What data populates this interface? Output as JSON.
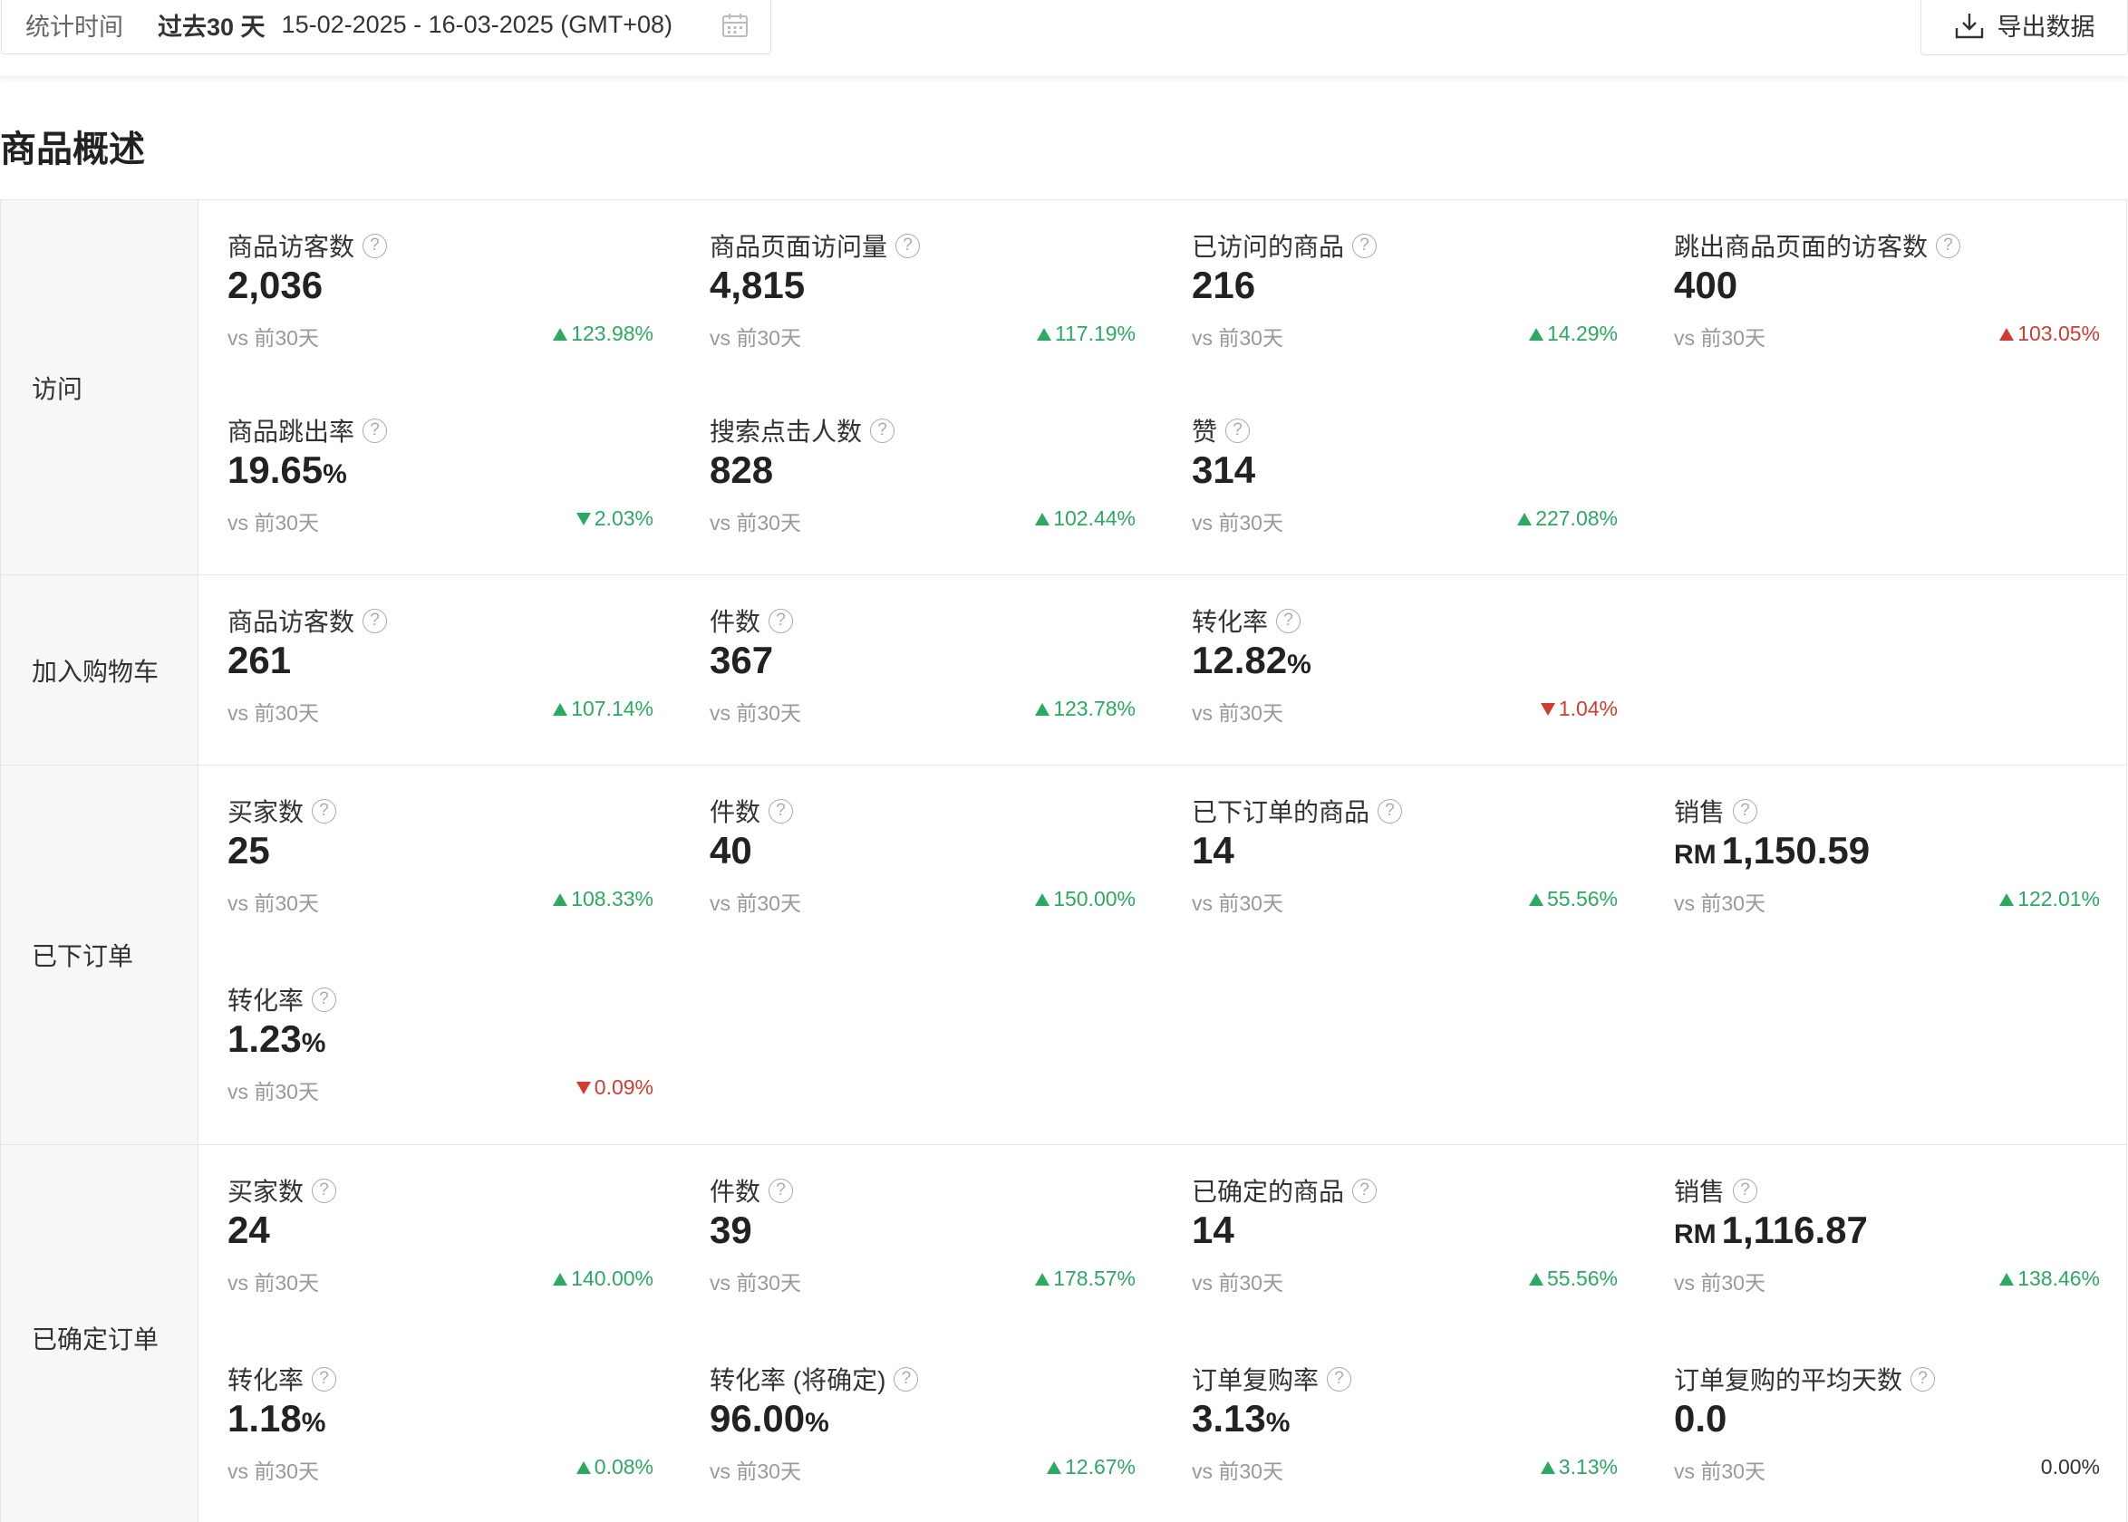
{
  "toolbar": {
    "stat_label": "统计时间",
    "range_label": "过去30 天",
    "date_range": "15-02-2025 - 16-03-2025 (GMT+08)",
    "calendar_icon": "calendar-icon",
    "export_label": "导出数据",
    "export_icon": "download-icon"
  },
  "section_title": "商品概述",
  "colors": {
    "up": "#2bab62",
    "down_red": "#d43b2f",
    "label_bg": "#f7f7f7"
  },
  "groups": [
    {
      "label": "访问",
      "metrics": [
        {
          "title": "商品访客数",
          "value": "2,036",
          "cmp": "vs 前30天",
          "change": "123.98%",
          "dir": "up",
          "color": "green"
        },
        {
          "title": "商品页面访问量",
          "value": "4,815",
          "cmp": "vs 前30天",
          "change": "117.19%",
          "dir": "up",
          "color": "green"
        },
        {
          "title": "已访问的商品",
          "value": "216",
          "cmp": "vs 前30天",
          "change": "14.29%",
          "dir": "up",
          "color": "green"
        },
        {
          "title": "跳出商品页面的访客数",
          "value": "400",
          "cmp": "vs 前30天",
          "change": "103.05%",
          "dir": "up",
          "color": "red"
        },
        {
          "title": "商品跳出率",
          "value": "19.65",
          "unit": "%",
          "cmp": "vs 前30天",
          "change": "2.03%",
          "dir": "down",
          "color": "green"
        },
        {
          "title": "搜索点击人数",
          "value": "828",
          "cmp": "vs 前30天",
          "change": "102.44%",
          "dir": "up",
          "color": "green"
        },
        {
          "title": "赞",
          "value": "314",
          "cmp": "vs 前30天",
          "change": "227.08%",
          "dir": "up",
          "color": "green"
        }
      ]
    },
    {
      "label": "加入购物车",
      "metrics": [
        {
          "title": "商品访客数",
          "value": "261",
          "cmp": "vs 前30天",
          "change": "107.14%",
          "dir": "up",
          "color": "green"
        },
        {
          "title": "件数",
          "value": "367",
          "cmp": "vs 前30天",
          "change": "123.78%",
          "dir": "up",
          "color": "green"
        },
        {
          "title": "转化率",
          "value": "12.82",
          "unit": "%",
          "cmp": "vs 前30天",
          "change": "1.04%",
          "dir": "down",
          "color": "red"
        }
      ]
    },
    {
      "label": "已下订单",
      "metrics": [
        {
          "title": "买家数",
          "value": "25",
          "cmp": "vs 前30天",
          "change": "108.33%",
          "dir": "up",
          "color": "green"
        },
        {
          "title": "件数",
          "value": "40",
          "cmp": "vs 前30天",
          "change": "150.00%",
          "dir": "up",
          "color": "green"
        },
        {
          "title": "已下订单的商品",
          "value": "14",
          "cmp": "vs 前30天",
          "change": "55.56%",
          "dir": "up",
          "color": "green"
        },
        {
          "title": "销售",
          "currency": "RM",
          "value": "1,150.59",
          "cmp": "vs 前30天",
          "change": "122.01%",
          "dir": "up",
          "color": "green"
        },
        {
          "title": "转化率",
          "value": "1.23",
          "unit": "%",
          "cmp": "vs 前30天",
          "change": "0.09%",
          "dir": "down",
          "color": "red"
        }
      ]
    },
    {
      "label": "已确定订单",
      "metrics": [
        {
          "title": "买家数",
          "value": "24",
          "cmp": "vs 前30天",
          "change": "140.00%",
          "dir": "up",
          "color": "green"
        },
        {
          "title": "件数",
          "value": "39",
          "cmp": "vs 前30天",
          "change": "178.57%",
          "dir": "up",
          "color": "green"
        },
        {
          "title": "已确定的商品",
          "value": "14",
          "cmp": "vs 前30天",
          "change": "55.56%",
          "dir": "up",
          "color": "green"
        },
        {
          "title": "销售",
          "currency": "RM",
          "value": "1,116.87",
          "cmp": "vs 前30天",
          "change": "138.46%",
          "dir": "up",
          "color": "green"
        },
        {
          "title": "转化率",
          "value": "1.18",
          "unit": "%",
          "cmp": "vs 前30天",
          "change": "0.08%",
          "dir": "up",
          "color": "green"
        },
        {
          "title": "转化率 (将确定)",
          "value": "96.00",
          "unit": "%",
          "cmp": "vs 前30天",
          "change": "12.67%",
          "dir": "up",
          "color": "green"
        },
        {
          "title": "订单复购率",
          "value": "3.13",
          "unit": "%",
          "cmp": "vs 前30天",
          "change": "3.13%",
          "dir": "up",
          "color": "green"
        },
        {
          "title": "订单复购的平均天数",
          "value": "0.0",
          "cmp": "vs 前30天",
          "change": "0.00%",
          "dir": "none",
          "color": "neutral"
        }
      ]
    }
  ]
}
